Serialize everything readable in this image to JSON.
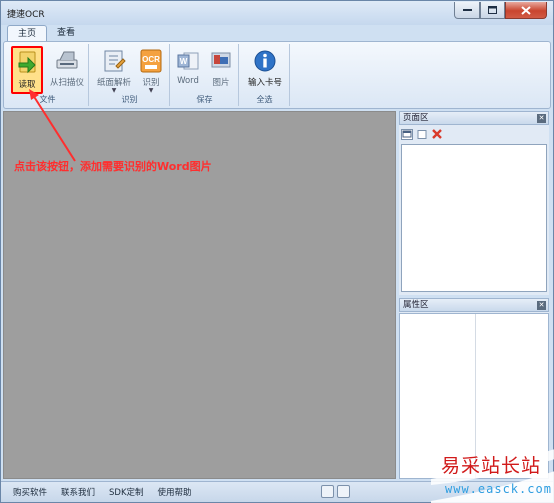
{
  "window": {
    "title": "捷速OCR"
  },
  "tabs": [
    {
      "label": "主页",
      "active": true
    },
    {
      "label": "查看",
      "active": false
    }
  ],
  "ribbon": {
    "groups": [
      {
        "label": "文件",
        "buttons": [
          {
            "label": "读取",
            "icon": "open-file-icon",
            "highlighted": true
          },
          {
            "label": "从扫描仪",
            "icon": "scanner-icon"
          }
        ]
      },
      {
        "label": "识别",
        "buttons": [
          {
            "label": "纸面解析",
            "icon": "layout-analysis-icon",
            "dropdown": true
          },
          {
            "label": "识别",
            "icon": "ocr-icon",
            "dropdown": true
          }
        ]
      },
      {
        "label": "保存",
        "buttons": [
          {
            "label": "Word",
            "icon": "word-icon"
          },
          {
            "label": "图片",
            "icon": "image-icon"
          }
        ]
      },
      {
        "label": "全选",
        "buttons": [
          {
            "label": "输入卡号",
            "icon": "info-icon"
          }
        ]
      }
    ]
  },
  "annotation": {
    "text": "点击该按钮，添加需要识别的Word图片",
    "color": "#ff2e2e"
  },
  "panels": {
    "page": {
      "title": "页面区",
      "toolbar": [
        "page-layout-icon",
        "page-blank-icon",
        "delete-icon"
      ]
    },
    "properties": {
      "title": "属性区"
    }
  },
  "statusbar": {
    "links": [
      "购买软件",
      "联系我们",
      "SDK定制",
      "使用帮助"
    ]
  },
  "watermark": {
    "text_cn": "易采站长站",
    "url": "www.easck.com"
  },
  "colors": {
    "workspace": "#9e9e9e",
    "highlight_border": "#ff0000",
    "accent": "#cfe0f2"
  }
}
